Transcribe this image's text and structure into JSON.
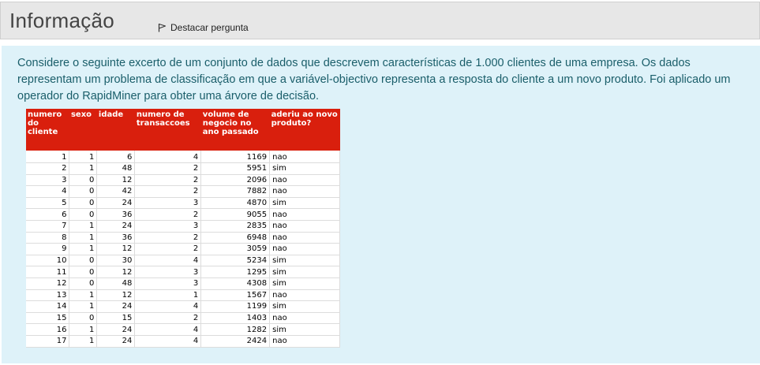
{
  "header": {
    "title": "Informação",
    "flag_label": "Destacar pergunta"
  },
  "content": {
    "intro": "Considere o seguinte excerto de um conjunto de dados que descrevem características de 1.000 clientes de uma empresa. Os dados representam um problema de classificação em que a variável-objectivo representa a resposta do cliente a um novo produto. Foi aplicado um operador do RapidMiner para obter uma árvore de decisão."
  },
  "table": {
    "columns": [
      "numero do cliente",
      "sexo",
      "idade",
      "numero de transaccoes",
      "volume de negocio no ano passado",
      "aderiu ao novo produto?"
    ],
    "rows": [
      [
        "1",
        "1",
        "6",
        "4",
        "1169",
        "nao"
      ],
      [
        "2",
        "1",
        "48",
        "2",
        "5951",
        "sim"
      ],
      [
        "3",
        "0",
        "12",
        "2",
        "2096",
        "nao"
      ],
      [
        "4",
        "0",
        "42",
        "2",
        "7882",
        "nao"
      ],
      [
        "5",
        "0",
        "24",
        "3",
        "4870",
        "sim"
      ],
      [
        "6",
        "0",
        "36",
        "2",
        "9055",
        "nao"
      ],
      [
        "7",
        "1",
        "24",
        "3",
        "2835",
        "nao"
      ],
      [
        "8",
        "1",
        "36",
        "2",
        "6948",
        "nao"
      ],
      [
        "9",
        "1",
        "12",
        "2",
        "3059",
        "nao"
      ],
      [
        "10",
        "0",
        "30",
        "4",
        "5234",
        "sim"
      ],
      [
        "11",
        "0",
        "12",
        "3",
        "1295",
        "sim"
      ],
      [
        "12",
        "0",
        "48",
        "3",
        "4308",
        "sim"
      ],
      [
        "13",
        "1",
        "12",
        "1",
        "1567",
        "nao"
      ],
      [
        "14",
        "1",
        "24",
        "4",
        "1199",
        "sim"
      ],
      [
        "15",
        "0",
        "15",
        "2",
        "1403",
        "nao"
      ],
      [
        "16",
        "1",
        "24",
        "4",
        "1282",
        "sim"
      ],
      [
        "17",
        "1",
        "24",
        "4",
        "2424",
        "nao"
      ]
    ]
  },
  "colors": {
    "header_bg": "#e7e7e7",
    "content_bg": "#def2f9",
    "text_teal": "#1a5e6a",
    "table_header_red": "#d91f0d"
  }
}
